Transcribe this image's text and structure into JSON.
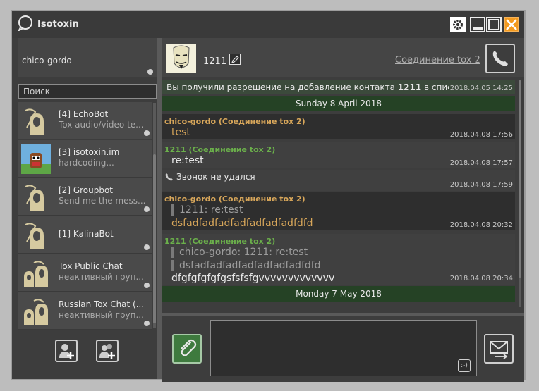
{
  "app": {
    "title": "Isotoxin"
  },
  "profile": {
    "name": "chico-gordo"
  },
  "search": {
    "placeholder": "Поиск"
  },
  "contacts": [
    {
      "name": "[4] EchoBot",
      "status": "Tox audio/video te..."
    },
    {
      "name": "[3] isotoxin.im",
      "status": "hardcoding..."
    },
    {
      "name": "[2] Groupbot",
      "status": "Send me the mess..."
    },
    {
      "name": "[1] KalinaBot",
      "status": ""
    },
    {
      "name": "Tox Public Chat",
      "status": "неактивный груп..."
    },
    {
      "name": "Russian Tox Chat (...",
      "status": "неактивный груп..."
    }
  ],
  "chat": {
    "contact_name": "1211",
    "connection_link": "Соединение tox 2"
  },
  "messages": {
    "system_prefix": "Вы получили разрешение на добавление контакта ",
    "system_contact": "1211",
    "system_suffix": " в список контактов",
    "system_time": "2018.04.05 14:25",
    "date1": "Sunday 8 April 2018",
    "m1_sender": "chico-gordo (Соединение tox 2)",
    "m1_text": "test",
    "m1_time": "2018.04.08 17:56",
    "m2_sender": "1211 (Соединение tox 2)",
    "m2_text": "re:test",
    "m2_time": "2018.04.08 17:57",
    "call_text": "Звонок не удался",
    "call_time": "2018.04.08 17:59",
    "m3_sender": "chico-gordo (Соединение tox 2)",
    "m3_quote": "1211: re:test",
    "m3_text": "dsfadfadfadfadfadfadfadfdfd",
    "m3_time": "2018.04.08 20:32",
    "m4_sender": "1211 (Соединение tox 2)",
    "m4_quote1": "chico-gordo: 1211: re:test",
    "m4_quote2": "dsfadfadfadfadfadfadfadfdfd",
    "m4_text": "dfgfgfgfgfgsfsfsfgvvvvvvvvvvvvv",
    "m4_time": "2018.04.08 20:34",
    "date2": "Monday 7 May 2018"
  },
  "compose": {
    "smile_label": ":-)"
  },
  "colors": {
    "accent_green": "#3e7a3e",
    "close_orange": "#f39a1f",
    "sender_orange": "#d7a65a",
    "sender_green": "#6bb04b",
    "date_bar": "#254225"
  }
}
